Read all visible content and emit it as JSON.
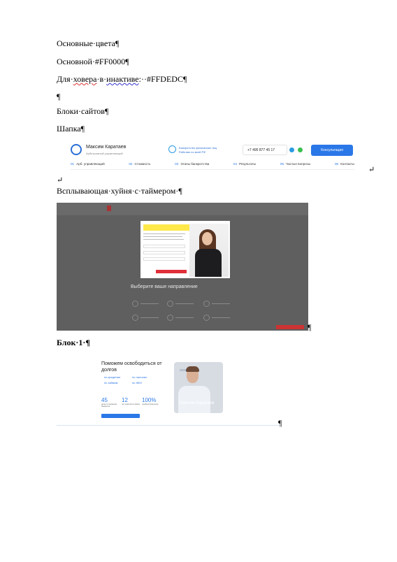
{
  "lines": {
    "l1": "Основные·цвета¶",
    "l2": "Основной·#FF0000¶",
    "l3a": "Для·",
    "l3b": "ховера",
    "l3c": "·в·",
    "l3d": "инактиве",
    "l3e": ":·",
    "l3f": "·#FFDEDC¶",
    "l4": "¶",
    "l5": "Блоки·сайтов¶",
    "l6": "Шапка¶",
    "l7": "↵",
    "l8": "Всплывающая·хуйня·с·таймером·¶",
    "l9": "Блок·1·¶"
  },
  "marks": {
    "after_header": "↵",
    "after_popup": "¶",
    "after_block1": "¶"
  },
  "header_img": {
    "name": "Максим Каратаев",
    "sub": "Арбитражный управляющий",
    "badge1": "Банкротство физических лиц",
    "badge2": "Работаю по всей РФ",
    "phone": "+7 495 877 45 17",
    "button": "Консультация",
    "nav": [
      {
        "n": "01",
        "t": "Арб. управляющий"
      },
      {
        "n": "02",
        "t": "Стоимость"
      },
      {
        "n": "03",
        "t": "Этапы банкротства"
      },
      {
        "n": "04",
        "t": "Результаты"
      },
      {
        "n": "05",
        "t": "Частые вопросы"
      },
      {
        "n": "06",
        "t": "Контакты"
      }
    ]
  },
  "popup_img": {
    "section_title": "Выберите ваше направление"
  },
  "block1_img": {
    "heading": "Поможем освободиться от долгов",
    "items": [
      "по кредитам",
      "по налогам",
      "по займам",
      "по ЖКХ"
    ],
    "stats": [
      {
        "v": "45",
        "l": "дела по снижению банкротов"
      },
      {
        "v": "12",
        "l": "лет практики в сфере"
      },
      {
        "v": "100%",
        "l": "профессиональное"
      }
    ],
    "card_name": "Максим Каратаев"
  },
  "colors": {
    "primary": "#FF0000",
    "hover_inactive": "#FFDEDC",
    "accent_blue": "#2A77E8"
  }
}
